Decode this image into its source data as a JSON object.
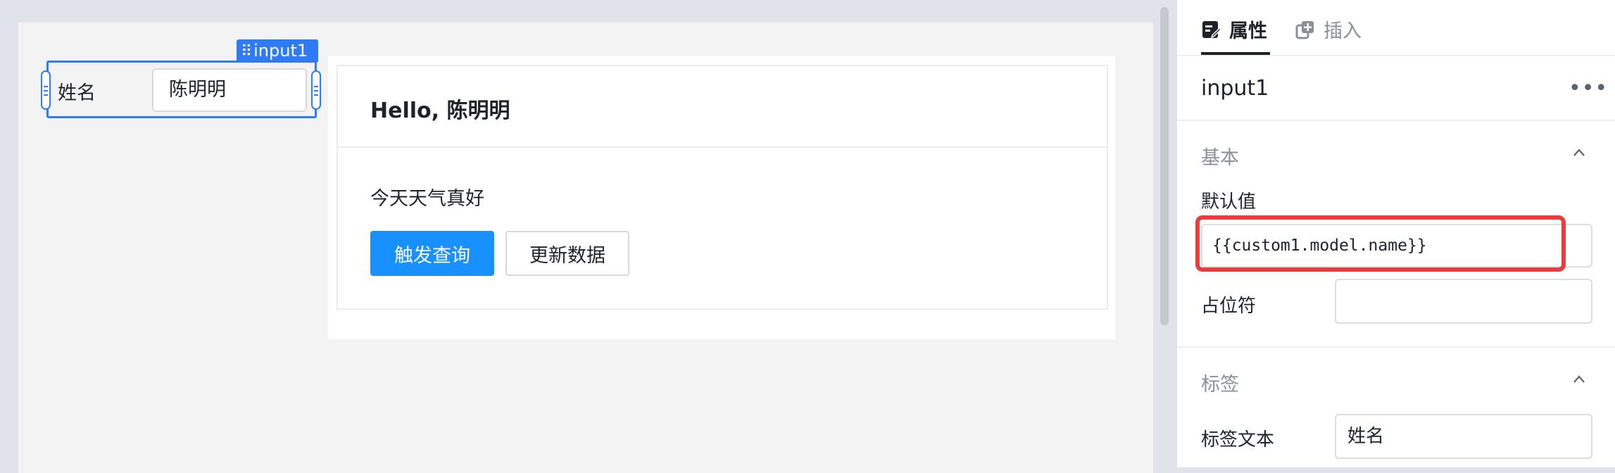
{
  "canvas": {
    "input_component": {
      "tag": "input1",
      "label": "姓名",
      "value": "陈明明"
    },
    "custom_component": {
      "title": "Hello, 陈明明",
      "text": "今天天气真好",
      "buttons": {
        "trigger": "触发查询",
        "update": "更新数据"
      }
    }
  },
  "panel": {
    "tabs": [
      {
        "label": "属性",
        "icon": "edit-icon",
        "active": true
      },
      {
        "label": "插入",
        "icon": "insert-icon",
        "active": false
      }
    ],
    "component_name": "input1",
    "more_label": "•••",
    "sections": {
      "basic": {
        "title": "基本",
        "default_value_label": "默认值",
        "default_value": "{{custom1.model.name}}",
        "placeholder_label": "占位符",
        "placeholder_value": ""
      },
      "label": {
        "title": "标签",
        "label_text_label": "标签文本",
        "label_text_value": "姓名"
      }
    }
  },
  "colors": {
    "selection": "#2f7bf5",
    "primary_button": "#1890ff",
    "highlight": "#e53e3e"
  }
}
